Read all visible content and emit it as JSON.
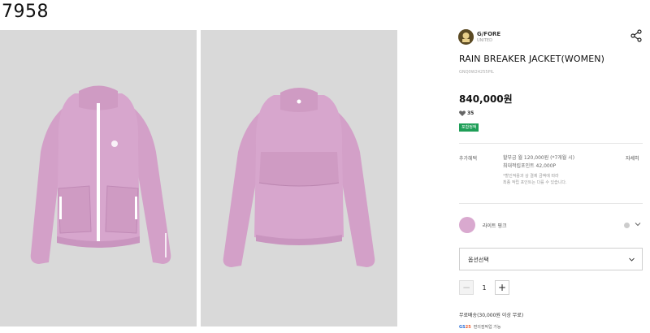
{
  "page": {
    "number": "7958"
  },
  "gallery": {
    "front_image": "pink-rain-jacket-front",
    "back_image": "pink-rain-jacket-back",
    "bg_color": "#d9d9d9",
    "jacket_color": "#d7a6cd"
  },
  "product": {
    "brand_name": "G/FORE",
    "brand_sub": "UNITED",
    "title": "RAIN BREAKER JACKET(WOMEN)",
    "code": "GNQ0W24255PIL",
    "price": "840,000원",
    "likes_count": "35",
    "badge": "포함정액"
  },
  "benefits": {
    "label": "추가혜택",
    "line1": "할부금 월 120,000원 (*7개월 시)",
    "line2": "최대적립포인트 42,000P",
    "note1": "*할인적용과 상 결제 금액에 따라",
    "note2": "최종 적립 포인트는 다를 수 있습니다.",
    "detail_link": "자세히"
  },
  "color_option": {
    "label": "라이트 핑크",
    "swatch": "#d9a9cf"
  },
  "option_select": {
    "label": "옵션선택"
  },
  "quantity": {
    "value": "1",
    "minus": "−",
    "plus": "+"
  },
  "shipping": {
    "text": "무료배송(30,000원 이상 무료)",
    "pay_logo_a": "GS",
    "pay_logo_b": "25",
    "pay_text": "편의점픽업 가능"
  },
  "icons": {
    "share": "share-icon",
    "heart": "heart-icon",
    "chevron": "chevron-down-icon"
  }
}
